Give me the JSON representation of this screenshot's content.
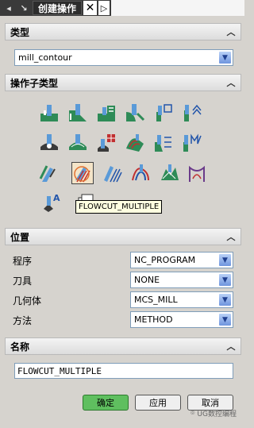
{
  "titlebar": {
    "back_icon": "back-arrow-icon",
    "title": "创建操作",
    "close": "✕",
    "next": "▷"
  },
  "sections": {
    "type": "类型",
    "subtype": "操作子类型",
    "position": "位置",
    "name": "名称"
  },
  "type_dropdown": {
    "value": "mill_contour"
  },
  "tooltip": "FLOWCUT_MULTIPLE",
  "position": {
    "program_label": "程序",
    "program_value": "NC_PROGRAM",
    "tool_label": "刀具",
    "tool_value": "NONE",
    "geometry_label": "几何体",
    "geometry_value": "MCS_MILL",
    "method_label": "方法",
    "method_value": "METHOD"
  },
  "name_value": "FLOWCUT_MULTIPLE",
  "buttons": {
    "ok": "确定",
    "apply": "应用",
    "cancel": "取消"
  },
  "watermark": "UG数控编程",
  "colors": {
    "panel_bg": "#d6d3ce",
    "ok_button": "#5fbf5f",
    "tooltip_bg": "#ffffe1",
    "dropdown_arrow": "#6f95de"
  }
}
